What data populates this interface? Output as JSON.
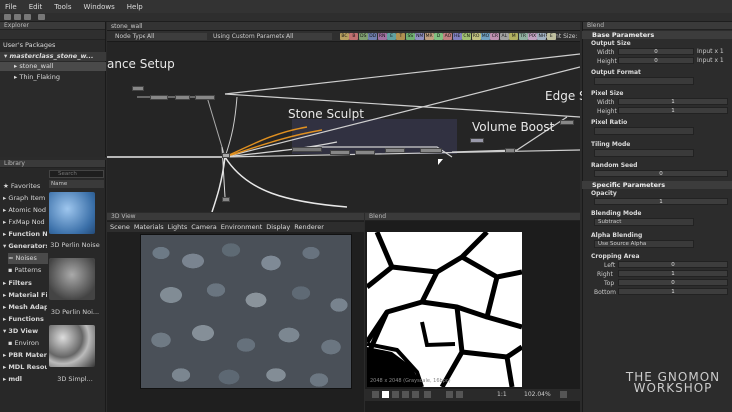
{
  "menu": [
    "File",
    "Edit",
    "Tools",
    "Windows",
    "Help"
  ],
  "explorer": {
    "title": "Explorer",
    "user_packages": "User's Packages",
    "package": "masterclass_stone_w...",
    "items": [
      "stone_wall",
      "Thin_Flaking"
    ]
  },
  "library": {
    "title": "Library",
    "search_placeholder": "Search",
    "name_header": "Name",
    "categories": [
      "Favorites",
      "Graph Item",
      "Atomic Nod",
      "FxMap Nod",
      "Function N",
      "Generators",
      "Noises",
      "Patterns",
      "Filters",
      "Material Fi",
      "Mesh Adap",
      "Functions",
      "3D View",
      "Environ",
      "PBR Mater",
      "MDL Resou",
      "mdl"
    ],
    "thumb_labels": [
      "3D Perlin Noise",
      "3D Perlin Noi...",
      "3D Simpl..."
    ]
  },
  "graph": {
    "tab": "stone_wall",
    "node_type_label": "Node Type",
    "node_type_value": "All",
    "custom_params_label": "Using Custom Parameters",
    "custom_params_value": "All",
    "parent_size_label": "Parent Size:",
    "frames": [
      "ance Setup",
      "Stone Sculpt",
      "Volume Boost",
      "Edge S"
    ],
    "tags": [
      "BC",
      "B",
      "DS",
      "DD",
      "RN",
      "E",
      "T",
      "SS",
      "NM",
      "MR",
      "D",
      "AO",
      "HE",
      "CN",
      "RO",
      "MO",
      "CR",
      "AL",
      "M",
      "TR",
      "PIX",
      "NH",
      "E"
    ]
  },
  "view3d": {
    "title": "3D View",
    "menu": [
      "Scene",
      "Materials",
      "Lights",
      "Camera",
      "Environment",
      "Display",
      "Renderer"
    ]
  },
  "view2d": {
    "title": "Blend",
    "info": "2048 x 2048 (Grayscale, 16bpc)",
    "ratio": "1:1",
    "zoom": "102.04%"
  },
  "props": {
    "title": "Blend",
    "base_params": "Base Parameters",
    "output_size": "Output Size",
    "width": "Width",
    "height": "Height",
    "width_val": "0",
    "height_val": "0",
    "width_input": "Input x 1",
    "height_input": "Input x 1",
    "output_format": "Output Format",
    "output_format_val": "",
    "pixel_size": "Pixel Size",
    "px_width_val": "1",
    "px_height_val": "1",
    "pixel_ratio": "Pixel Ratio",
    "tiling_mode": "Tiling Mode",
    "random_seed": "Random Seed",
    "random_seed_val": "0",
    "specific_params": "Specific Parameters",
    "opacity": "Opacity",
    "opacity_val": "1",
    "blending_mode": "Blending Mode",
    "blending_mode_val": "Subtract",
    "alpha_blending": "Alpha Blending",
    "alpha_blending_val": "Use Source Alpha",
    "cropping_area": "Cropping Area",
    "left": "Left",
    "right": "Right",
    "top": "Top",
    "bottom": "Bottom",
    "left_val": "0",
    "right_val": "1",
    "top_val": "0",
    "bottom_val": "1"
  },
  "watermark": {
    "line1": "THE GNOMON",
    "line2": "WORKSHOP"
  },
  "colors": {
    "accent_orange": "#e09020",
    "tag_colors": [
      "#b8a060",
      "#c07070",
      "#80a070",
      "#7080b0",
      "#a070a0",
      "#60a0a0",
      "#b09050",
      "#70b070",
      "#9090c0",
      "#c0a080",
      "#80c080",
      "#c08080",
      "#8080c0",
      "#a0c070",
      "#c0c080",
      "#70a0c0",
      "#c090b0",
      "#a0a0a0",
      "#b0b060",
      "#90b0a0",
      "#c0a0c0",
      "#a0b0c0",
      "#c0c0a0"
    ]
  }
}
